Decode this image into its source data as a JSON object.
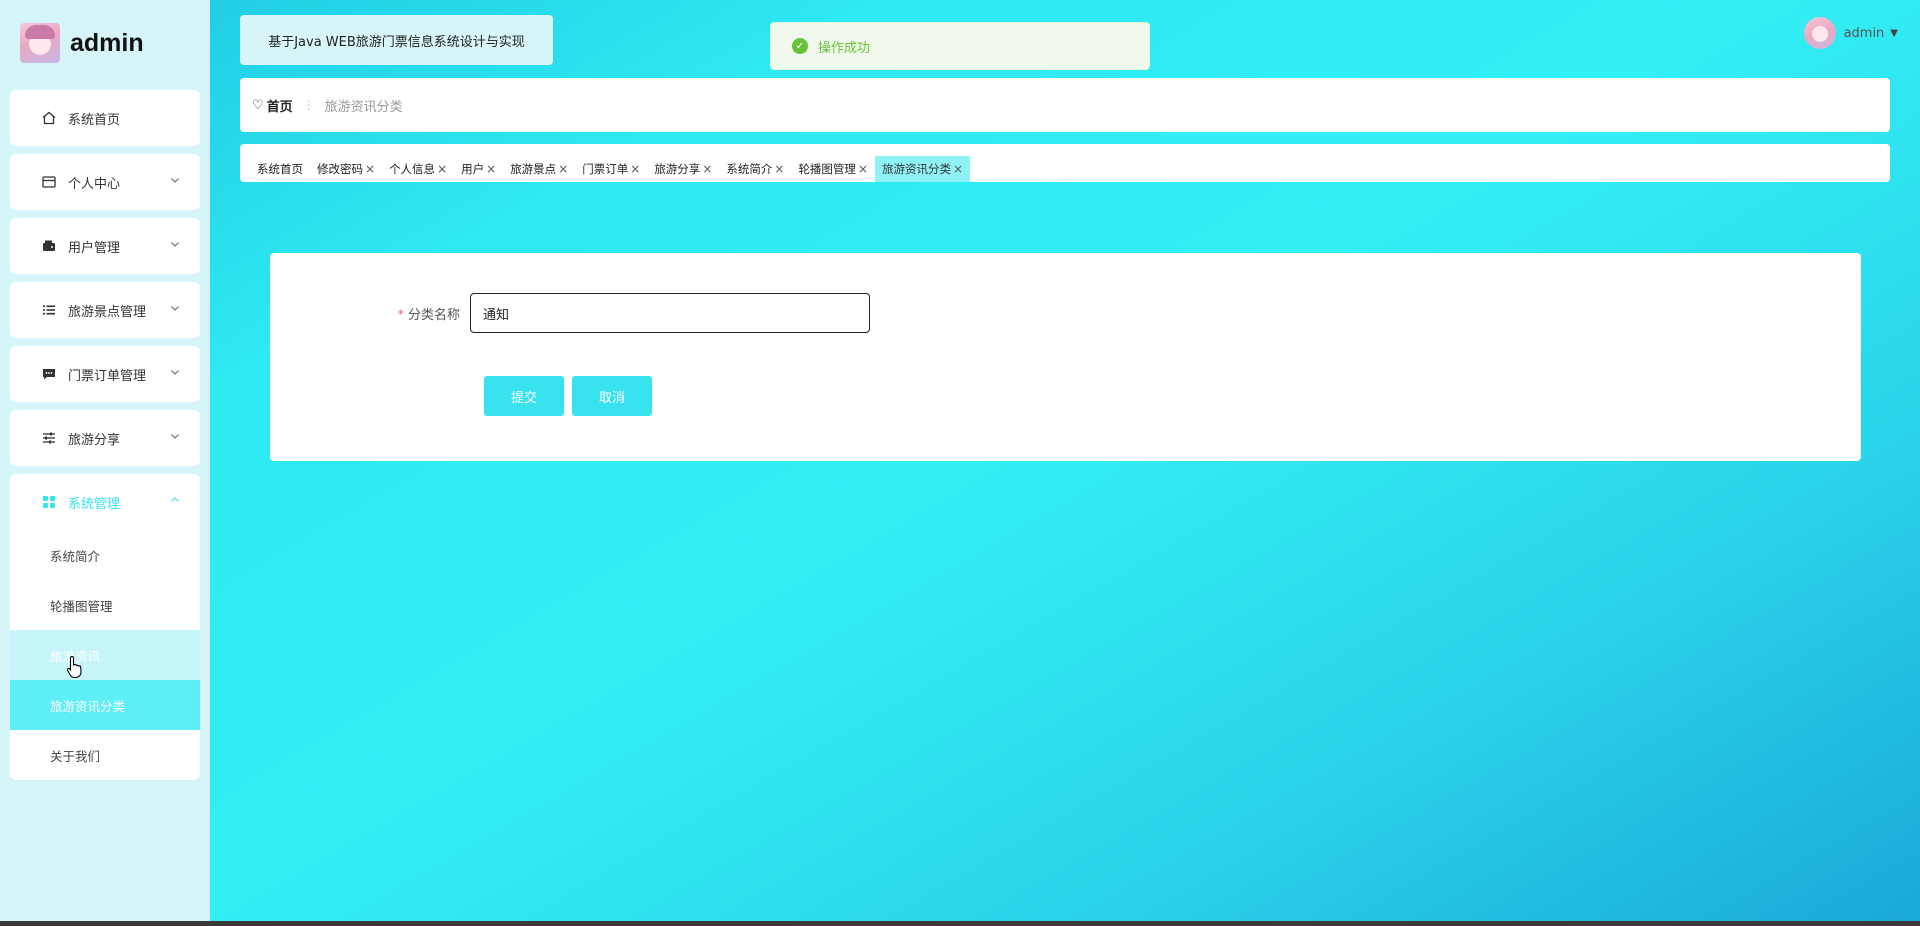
{
  "brand": {
    "title": "admin"
  },
  "header": {
    "system_title": "基于Java WEB旅游门票信息系统设计与实现",
    "toast_text": "操作成功",
    "user_name": "admin"
  },
  "sidebar": {
    "items": [
      {
        "label": "系统首页",
        "icon": "home-icon"
      },
      {
        "label": "个人中心",
        "icon": "card-icon"
      },
      {
        "label": "用户管理",
        "icon": "wallet-icon"
      },
      {
        "label": "旅游景点管理",
        "icon": "list-icon"
      },
      {
        "label": "门票订单管理",
        "icon": "chat-icon"
      },
      {
        "label": "旅游分享",
        "icon": "sliders-icon"
      }
    ],
    "group": {
      "label": "系统管理",
      "icon": "grid-icon",
      "subitems": [
        {
          "label": "系统简介"
        },
        {
          "label": "轮播图管理"
        },
        {
          "label": "旅游资讯"
        },
        {
          "label": "旅游资讯分类"
        },
        {
          "label": "关于我们"
        }
      ]
    }
  },
  "breadcrumb": {
    "home": "首页",
    "current": "旅游资讯分类"
  },
  "tags": [
    {
      "label": "系统首页",
      "closable": false
    },
    {
      "label": "修改密码",
      "closable": true
    },
    {
      "label": "个人信息",
      "closable": true
    },
    {
      "label": "用户",
      "closable": true
    },
    {
      "label": "旅游景点",
      "closable": true
    },
    {
      "label": "门票订单",
      "closable": true
    },
    {
      "label": "旅游分享",
      "closable": true
    },
    {
      "label": "系统简介",
      "closable": true
    },
    {
      "label": "轮播图管理",
      "closable": true
    },
    {
      "label": "旅游资讯分类",
      "closable": true,
      "active": true
    }
  ],
  "form": {
    "required_mark": "*",
    "field_label": "分类名称",
    "field_value": "通知",
    "submit_label": "提交",
    "cancel_label": "取消"
  },
  "colors": {
    "accent": "#38e3ef",
    "success": "#67c23a",
    "required": "#f56c6c"
  }
}
